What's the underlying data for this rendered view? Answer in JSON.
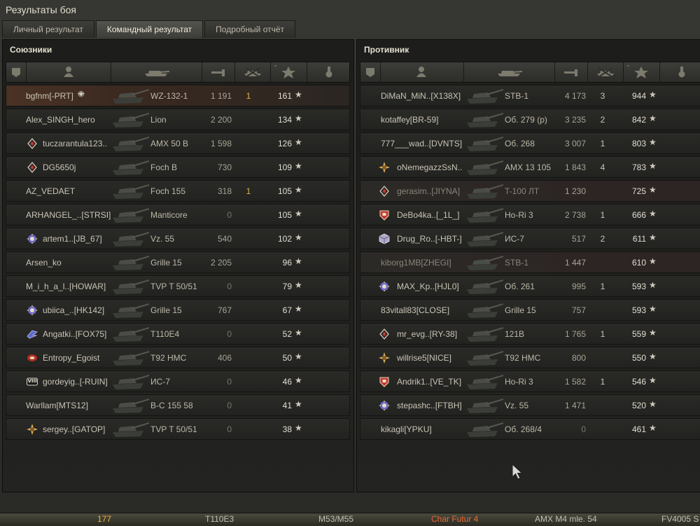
{
  "window": {
    "title": "Результаты боя"
  },
  "tabs": [
    {
      "label": "Личный результат",
      "active": false
    },
    {
      "label": "Командный результат",
      "active": true
    },
    {
      "label": "Подробный отчёт",
      "active": false
    }
  ],
  "columns": {
    "sort_arrow": "⌄",
    "icons": [
      "rank-icon",
      "player-icon",
      "tank-icon",
      "damage-icon",
      "kills-icon",
      "experience-icon",
      "medal-icon"
    ]
  },
  "star_glyph": "★",
  "allies": {
    "title": "Союзники",
    "rows": [
      {
        "player": "bgfnm[-PRT]",
        "vehicle": "WZ-132-1",
        "damage": "1 191",
        "kills": "1",
        "xp": "161",
        "highlight": true,
        "hidden": true
      },
      {
        "player": "Alex_SINGH_hero",
        "vehicle": "Lion",
        "damage": "2 200",
        "kills": "",
        "xp": "134"
      },
      {
        "player": "tuczarantula123..",
        "vehicle": "AMX 50 B",
        "damage": "1 598",
        "kills": "",
        "xp": "126",
        "badge": "diamond"
      },
      {
        "player": "DG5650j",
        "vehicle": "Foch B",
        "damage": "730",
        "kills": "",
        "xp": "109",
        "badge": "diamond"
      },
      {
        "player": "AZ_VEDAET",
        "vehicle": "Foch 155",
        "damage": "318",
        "kills": "1",
        "xp": "105"
      },
      {
        "player": "ARHANGEL_..[STRSI]",
        "vehicle": "Manticore",
        "damage": "0",
        "kills": "",
        "xp": "105"
      },
      {
        "player": "artem1..[JB_67]",
        "vehicle": "Vz. 55",
        "damage": "540",
        "kills": "",
        "xp": "102",
        "badge": "gear"
      },
      {
        "player": "Arsen_ko",
        "vehicle": "Grille 15",
        "damage": "2 205",
        "kills": "",
        "xp": "96"
      },
      {
        "player": "M_i_h_a_l..[HOWAR]",
        "vehicle": "TVP T 50/51",
        "damage": "0",
        "kills": "",
        "xp": "79"
      },
      {
        "player": "ubiica_..[HK142]",
        "vehicle": "Grille 15",
        "damage": "767",
        "kills": "",
        "xp": "67",
        "badge": "gear"
      },
      {
        "player": "Angatki..[FOX75]",
        "vehicle": "T110E4",
        "damage": "0",
        "kills": "",
        "xp": "52",
        "badge": "wing"
      },
      {
        "player": "Entropy_Egoist",
        "vehicle": "T92 HMC",
        "damage": "406",
        "kills": "",
        "xp": "50",
        "badge": "red"
      },
      {
        "player": "gordeyig..[-RUIN]",
        "vehicle": "ИС-7",
        "damage": "0",
        "kills": "",
        "xp": "46",
        "badge": "viii",
        "badge_text": "VIII"
      },
      {
        "player": "Warllam[MTS12]",
        "vehicle": "B-C 155 58",
        "damage": "0",
        "kills": "",
        "xp": "41"
      },
      {
        "player": "sergey..[GATOP]",
        "vehicle": "TVP T 50/51",
        "damage": "0",
        "kills": "",
        "xp": "38",
        "badge": "gold"
      }
    ]
  },
  "enemies": {
    "title": "Противник",
    "rows": [
      {
        "player": "DiMaN_MiN..[X138X]",
        "vehicle": "STB-1",
        "damage": "4 173",
        "kills": "3",
        "xp": "944"
      },
      {
        "player": "kotaffey[BR-59]",
        "vehicle": "Об. 279 (р)",
        "damage": "3 235",
        "kills": "2",
        "xp": "842"
      },
      {
        "player": "777___wad..[DVNTS]",
        "vehicle": "Об. 268",
        "damage": "3 007",
        "kills": "1",
        "xp": "803"
      },
      {
        "player": "oNemegazzSsN..",
        "vehicle": "AMX 13 105",
        "damage": "1 843",
        "kills": "4",
        "xp": "783",
        "badge": "gold"
      },
      {
        "player": "gerasim..[JIYNA]",
        "vehicle": "T-100 ЛТ",
        "damage": "1 230",
        "kills": "",
        "xp": "725",
        "badge": "diamond",
        "dead": true
      },
      {
        "player": "DeBo4ka..[_1L_]",
        "vehicle": "Ho-Ri 3",
        "damage": "2 738",
        "kills": "1",
        "xp": "666",
        "badge": "shield"
      },
      {
        "player": "Drug_Ro..[-HBT-]",
        "vehicle": "ИС-7",
        "damage": "517",
        "kills": "2",
        "xp": "611",
        "badge": "cube"
      },
      {
        "player": "kiborg1MB[ZHEGI]",
        "vehicle": "STB-1",
        "damage": "1 447",
        "kills": "",
        "xp": "610",
        "dead": true
      },
      {
        "player": "MAX_Kp..[HJL0]",
        "vehicle": "Об. 261",
        "damage": "995",
        "kills": "1",
        "xp": "593",
        "badge": "gear"
      },
      {
        "player": "83vitall83[CLOSE]",
        "vehicle": "Grille 15",
        "damage": "757",
        "kills": "",
        "xp": "593"
      },
      {
        "player": "mr_evg..[RY-38]",
        "vehicle": "121B",
        "damage": "1 765",
        "kills": "1",
        "xp": "559",
        "badge": "diamond"
      },
      {
        "player": "willrise5[NICE]",
        "vehicle": "T92 HMC",
        "damage": "800",
        "kills": "",
        "xp": "550",
        "badge": "gold"
      },
      {
        "player": "Andrik1..[VE_TK]",
        "vehicle": "Ho-Ri 3",
        "damage": "1 582",
        "kills": "1",
        "xp": "546",
        "badge": "shield"
      },
      {
        "player": "stepashc..[FTBH]",
        "vehicle": "Vz. 55",
        "damage": "1 471",
        "kills": "",
        "xp": "520",
        "badge": "gear"
      },
      {
        "player": "kikagli[YPKU]",
        "vehicle": "Об. 268/4",
        "damage": "0",
        "kills": "",
        "xp": "461"
      }
    ]
  },
  "footer": {
    "items": [
      {
        "text": "177",
        "style": "gold"
      },
      {
        "text": "T110E3",
        "style": ""
      },
      {
        "text": "M53/M55",
        "style": ""
      },
      {
        "text": "Char Futur 4",
        "style": "red"
      },
      {
        "text": "AMX M4 mle. 54",
        "style": ""
      },
      {
        "text": "FV4005 S",
        "style": ""
      }
    ]
  },
  "colors": {
    "accent": "#e9e5d5",
    "kills": "#d5b84a",
    "highlight_row": "#4a3225"
  }
}
